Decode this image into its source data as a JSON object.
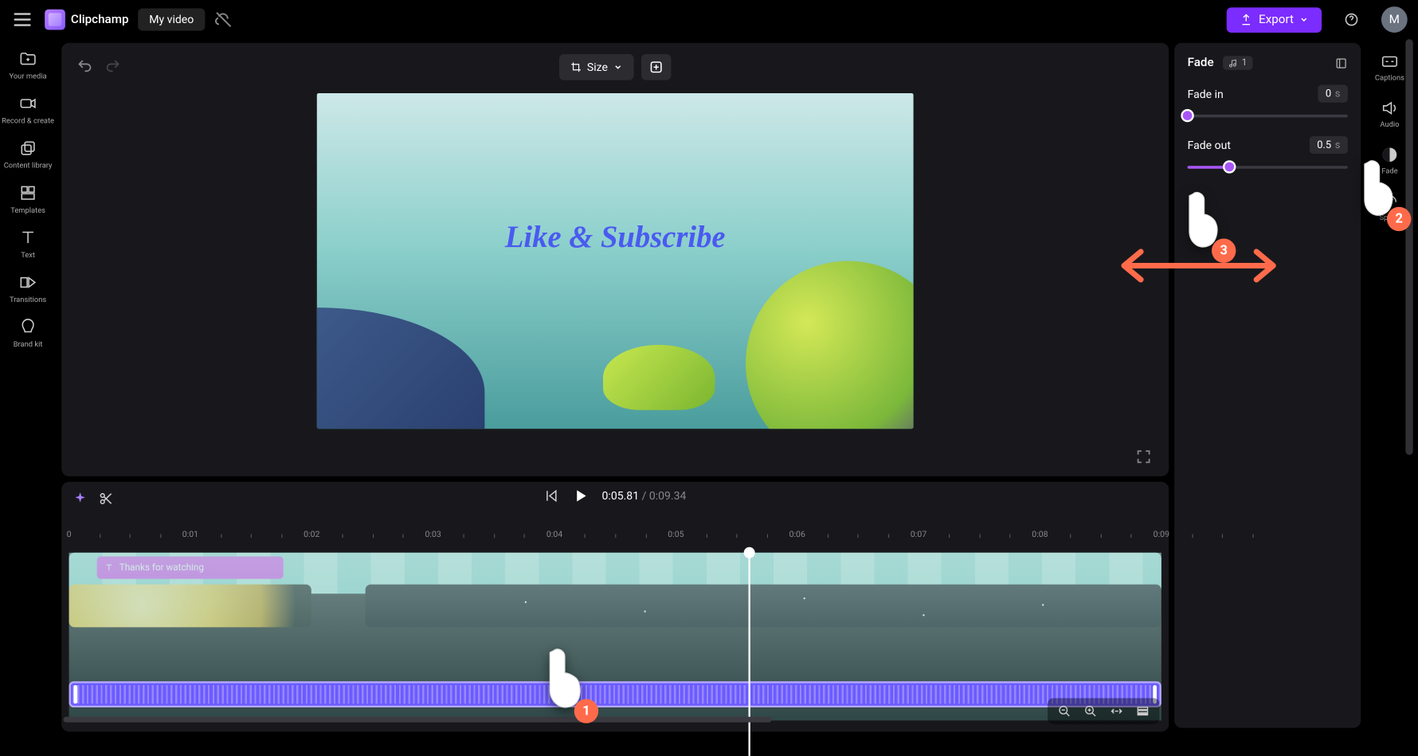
{
  "app": {
    "name": "Clipchamp",
    "project": "My video"
  },
  "topbar": {
    "export": "Export",
    "avatar_initial": "M"
  },
  "leftnav": [
    {
      "id": "your-media",
      "label": "Your media"
    },
    {
      "id": "record",
      "label": "Record & create"
    },
    {
      "id": "content",
      "label": "Content library"
    },
    {
      "id": "templates",
      "label": "Templates"
    },
    {
      "id": "text",
      "label": "Text"
    },
    {
      "id": "transitions",
      "label": "Transitions"
    },
    {
      "id": "brand",
      "label": "Brand kit"
    }
  ],
  "toolbar": {
    "size": "Size"
  },
  "preview": {
    "overlay_text": "Like & Subscribe"
  },
  "playback": {
    "current": "0:05.81",
    "duration": "0:09.34"
  },
  "ruler": [
    "0",
    "0:01",
    "0:02",
    "0:03",
    "0:04",
    "0:05",
    "0:06",
    "0:07",
    "0:08",
    "0:09"
  ],
  "clips": {
    "text_clip": "Thanks for watching"
  },
  "panel": {
    "title": "Fade",
    "badge_count": "1",
    "fade_in": {
      "label": "Fade in",
      "value": "0",
      "unit": "s",
      "percent": 0
    },
    "fade_out": {
      "label": "Fade out",
      "value": "0.5",
      "unit": "s",
      "percent": 26
    }
  },
  "rightnav": [
    {
      "id": "captions",
      "label": "Captions"
    },
    {
      "id": "audio",
      "label": "Audio"
    },
    {
      "id": "fade",
      "label": "Fade"
    },
    {
      "id": "speed",
      "label": "Speed"
    }
  ],
  "annotations": {
    "p1": "1",
    "p2": "2",
    "p3": "3"
  }
}
